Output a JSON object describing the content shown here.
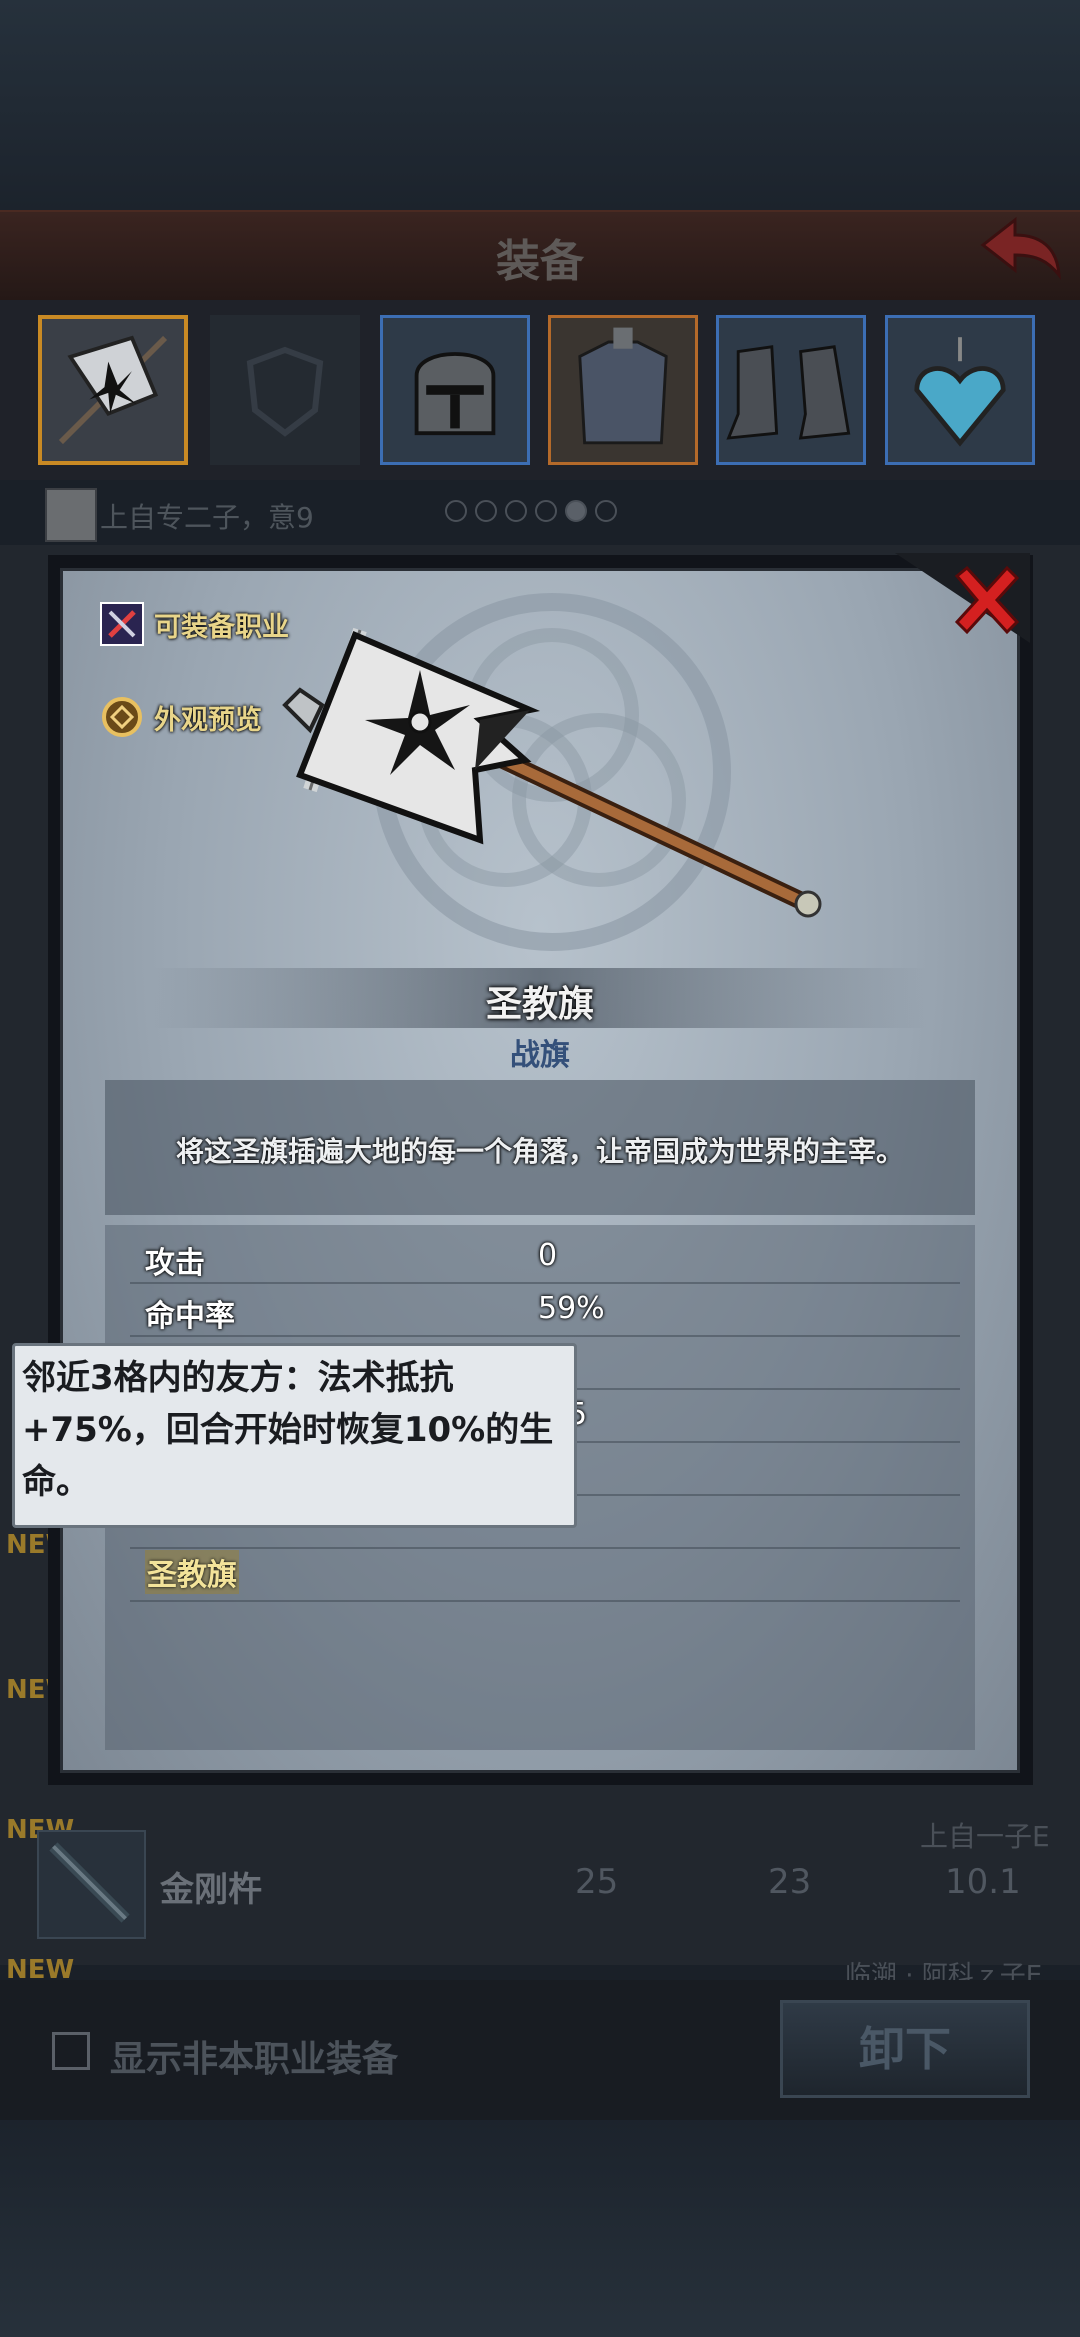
{
  "header": {
    "title": "装备"
  },
  "equipment_slots": [
    {
      "name": "banner",
      "selected": true
    },
    {
      "name": "shield-empty",
      "selected": false
    },
    {
      "name": "helmet",
      "selected": false
    },
    {
      "name": "armor",
      "selected": false
    },
    {
      "name": "boots",
      "selected": false
    },
    {
      "name": "amulet",
      "selected": false
    }
  ],
  "owner": {
    "name": "上自专二子，意9"
  },
  "list": {
    "new_label": "NEW",
    "row": {
      "name": "金刚杵",
      "v1": "25",
      "v2": "23",
      "v3": "10.1",
      "owner": "上自一子E"
    },
    "row2_owner": "临溯 · 阿科ｚ子E"
  },
  "footer": {
    "checkbox_label": "显示非本职业装备",
    "unequip_label": "卸下"
  },
  "modal": {
    "class_button": "可装备职业",
    "look_button": "外观预览",
    "item_name": "圣教旗",
    "item_type": "战旗",
    "description": "将这圣旗插遍大地的每一个角落，让帝国成为世界的主宰。",
    "stats": [
      {
        "label": "攻击",
        "value": "0"
      },
      {
        "label": "命中率",
        "value": "59%"
      }
    ],
    "partial_value": "5",
    "skill_name": "圣教旗"
  },
  "tooltip": {
    "text": "邻近3格内的友方：法术抵抗+75%，回合开始时恢复10%的生命。"
  },
  "colors": {
    "accent_gold": "#e8d58a",
    "close_red": "#d42020",
    "type_blue": "#34507a"
  }
}
